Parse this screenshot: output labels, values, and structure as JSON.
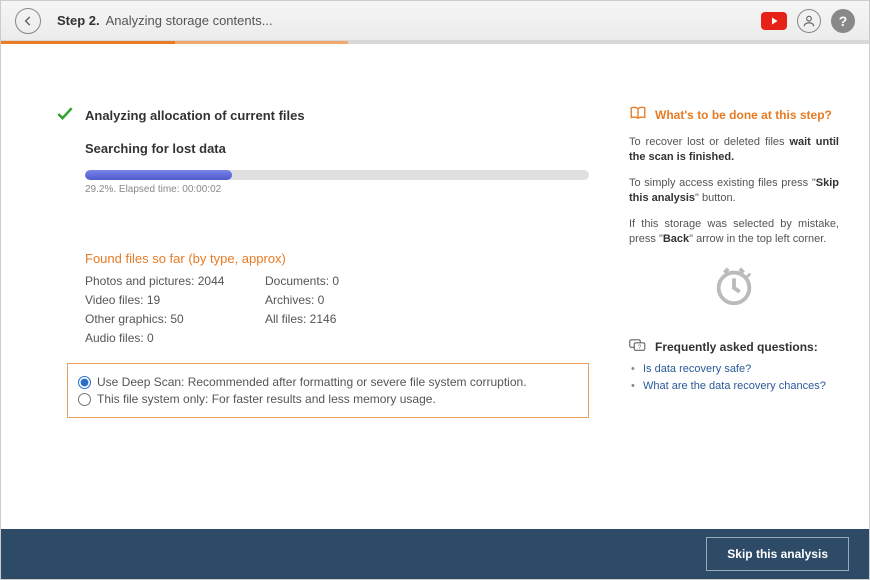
{
  "header": {
    "step_label": "Step 2.",
    "step_text": "Analyzing storage contents..."
  },
  "main": {
    "title": "Analyzing allocation of current files",
    "subtitle": "Searching for lost data",
    "progress_pct": "29.2%",
    "progress_text": "29.2%. Elapsed time: 00:00:02"
  },
  "found": {
    "title": "Found files so far (by type, approx)",
    "items": {
      "photos": "Photos and pictures: 2044",
      "documents": "Documents: 0",
      "video": "Video files: 19",
      "archives": "Archives: 0",
      "other": "Other graphics: 50",
      "all": "All files: 2146",
      "audio": "Audio files: 0"
    }
  },
  "scan": {
    "opt1": "Use Deep Scan: Recommended after formatting or severe file system corruption.",
    "opt2": "This file system only: For faster results and less memory usage."
  },
  "info": {
    "title": "What's to be done at this step?",
    "p1a": "To recover lost or deleted files ",
    "p1b": "wait until the scan is finished.",
    "p2a": "To simply access existing files press \"",
    "p2b": "Skip this analysis",
    "p2c": "\" button.",
    "p3a": "If this storage was selected by mistake, press \"",
    "p3b": "Back",
    "p3c": "\" arrow in the top left corner."
  },
  "faq": {
    "title": "Frequently asked questions:",
    "q1": "Is data recovery safe?",
    "q2": "What are the data recovery chances?"
  },
  "footer": {
    "skip": "Skip this analysis"
  }
}
